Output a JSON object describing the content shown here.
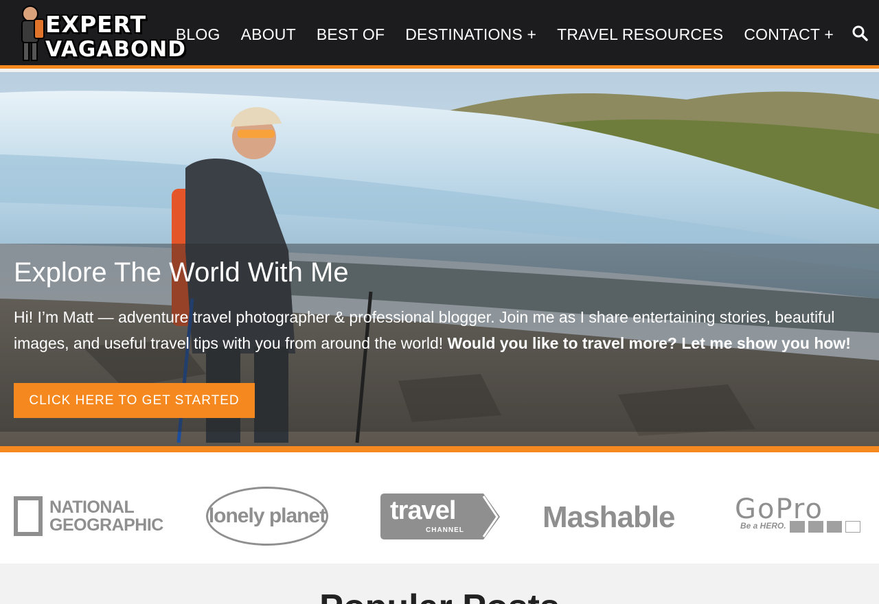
{
  "header": {
    "logo_line1": "EXPERT",
    "logo_line2": "VAGABOND",
    "nav": [
      "BLOG",
      "ABOUT",
      "BEST OF",
      "DESTINATIONS +",
      "TRAVEL RESOURCES",
      "CONTACT +"
    ],
    "search_icon": "search-icon"
  },
  "hero": {
    "title": "Explore The World With Me",
    "text": "Hi! I’m Matt — adventure travel photographer & professional blogger. Join me as I share entertaining stories, beautiful images, and useful travel tips with you from around the world!",
    "text_bold": "Would you like to travel more? Let me show you how!",
    "cta": "CLICK HERE TO GET STARTED"
  },
  "press": {
    "natgeo_1": "NATIONAL",
    "natgeo_2": "GEOGRAPHIC",
    "lonely": "lonely planet",
    "travel_1": "travel",
    "travel_2": "CHANNEL",
    "mashable": "Mashable",
    "gopro_1": "GoPro",
    "gopro_2": "Be a HERO."
  },
  "section": {
    "title": "Popular Posts"
  },
  "colors": {
    "accent": "#f5891f",
    "header_bg": "#1c1c1e"
  }
}
